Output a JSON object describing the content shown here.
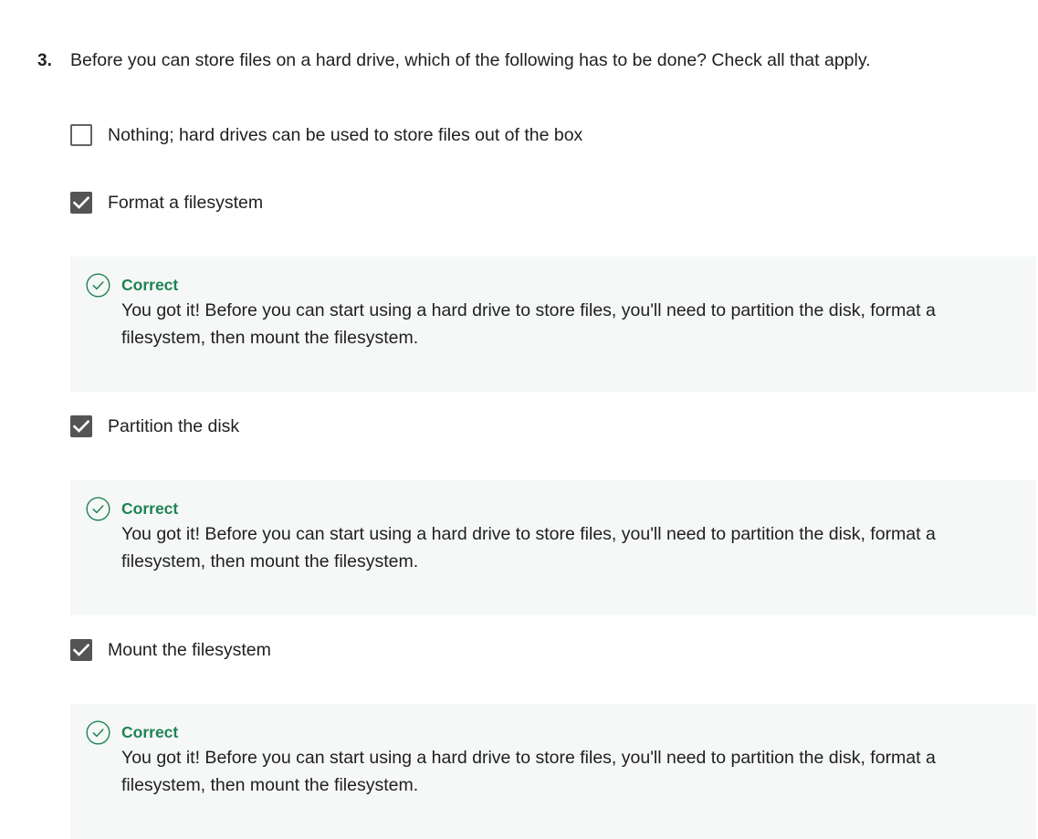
{
  "question": {
    "number": "3.",
    "text": "Before you can store files on a hard drive, which of the following has to be done? Check all that apply."
  },
  "options": [
    {
      "label": "Nothing; hard drives can be used to store files out of the box",
      "checked": false
    },
    {
      "label": "Format a filesystem",
      "checked": true
    },
    {
      "label": "Partition the disk",
      "checked": true
    },
    {
      "label": "Mount the filesystem",
      "checked": true
    }
  ],
  "feedback": [
    {
      "title": "Correct",
      "text": "You got it! Before you can start using a hard drive to store files, you'll need to partition the disk, format a filesystem, then mount the filesystem."
    },
    {
      "title": "Correct",
      "text": "You got it! Before you can start using a hard drive to store files, you'll need to partition the disk, format a filesystem, then mount the filesystem."
    },
    {
      "title": "Correct",
      "text": "You got it! Before you can start using a hard drive to store files, you'll need to partition the disk, format a filesystem, then mount the filesystem."
    }
  ],
  "colors": {
    "correct_green": "#1f8354",
    "checkbox_checked": "#545454",
    "feedback_background": "#f5f8f7"
  },
  "icons": {
    "checked": "checkmark-icon",
    "feedback": "check-circle-icon"
  }
}
